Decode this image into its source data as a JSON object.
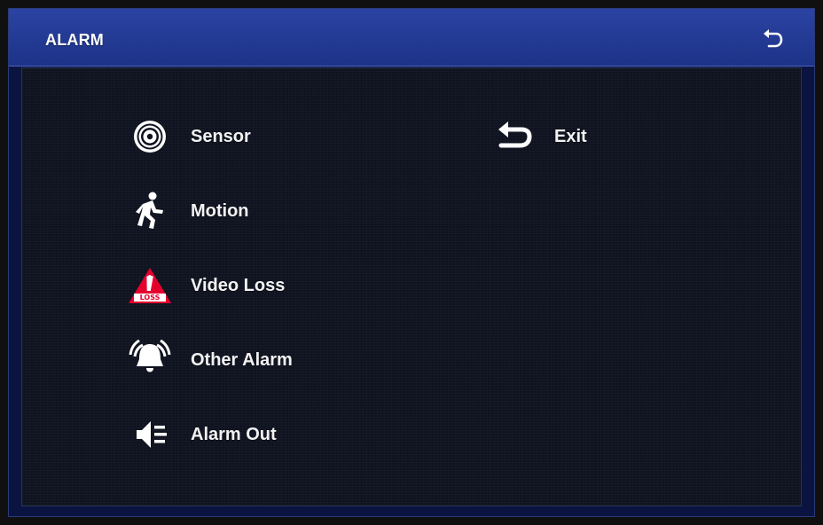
{
  "window": {
    "title": "ALARM"
  },
  "menu": {
    "items": [
      {
        "label": "Sensor",
        "icon": "sensor-icon"
      },
      {
        "label": "Motion",
        "icon": "motion-icon"
      },
      {
        "label": "Video Loss",
        "icon": "video-loss-icon"
      },
      {
        "label": "Other Alarm",
        "icon": "other-alarm-icon"
      },
      {
        "label": "Alarm Out",
        "icon": "alarm-out-icon"
      },
      {
        "label": "Exit",
        "icon": "exit-icon"
      }
    ]
  },
  "icons": {
    "back": "back-arrow-icon",
    "video_loss_badge": "LOSS"
  },
  "colors": {
    "titlebar": "#2b43a2",
    "panel": "#0f1320",
    "text": "#f2f2f2",
    "warning": "#e6002e"
  }
}
